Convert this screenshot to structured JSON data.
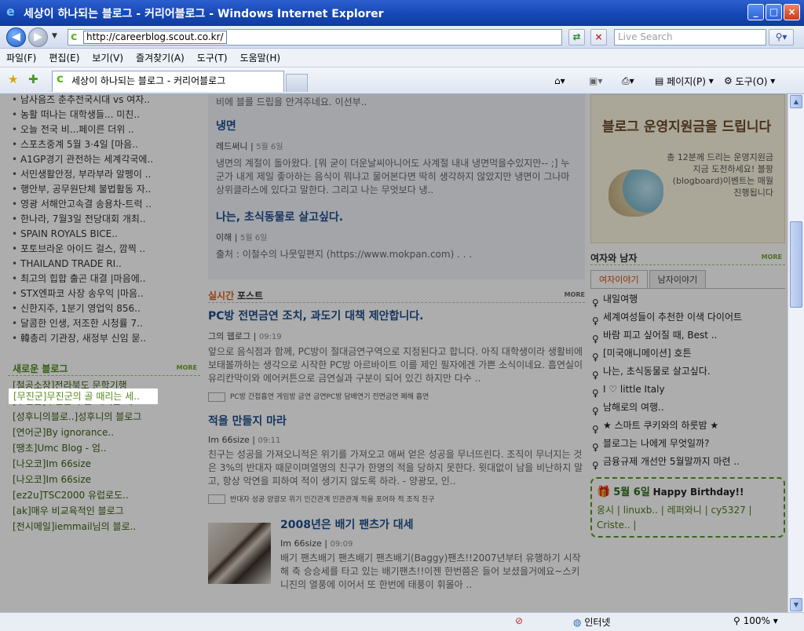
{
  "window": {
    "title": "세상이 하나되는 블로그 - 커리어블로그 - Windows Internet Explorer"
  },
  "address": {
    "url": "http://careerblog.scout.co.kr/",
    "search_placeholder": "Live Search"
  },
  "menu": [
    "파일(F)",
    "편집(E)",
    "보기(V)",
    "즐겨찾기(A)",
    "도구(T)",
    "도움말(H)"
  ],
  "tab": {
    "label": "세상이 하나되는 블로그 - 커리어블로그"
  },
  "toolbar": {
    "page_label": "페이지(P)",
    "tools_label": "도구(O)"
  },
  "left": {
    "top_list": [
      "남사음즈 춘추전국시대 vs 여자..",
      "농활 떠나는 대학생들... 미친..",
      "오늘 전국 비...페이른 더위 ..",
      "스포츠중계 5월 3·4일 [마음..",
      "A1GP경기 관전하는 세계각국에..",
      "서민생활안정, 부라부라 알펭이 ..",
      "행안부, 공무원단체 불법활동 자..",
      "영광 서해안고속결 송용차-트럭 ..",
      "한나라, 7월3일 전당대회 개최..",
      "SPAIN ROYALS BICE..",
      "포토브라운 아이드 걸스, 깜찍 ..",
      "THAILAND TRADE RI..",
      "최고의 힙합 출곤 대결 |마음에..",
      "STX엔파코 사장 송우익 |마음..",
      "신한지주, 1분기 영업익 856..",
      "달콤한 인생, 저조한 시청률 7..",
      "韓총리 기관장, 새정부 신임 묻.."
    ],
    "new_blogs_title": "새로운 블로그",
    "more": "MORE",
    "new_blogs": [
      "[철공소장]전라북도 문학기행",
      "[무진군]무진군의 골 때리는 세..",
      "[성후니의블로..]성후니의 블로그",
      "[연어군]By ignorance..",
      "[땡초]Umc Blog - 엄..",
      "[나오코]Im 66size",
      "[나오코]Im 66size",
      "[ez2u]TSC2000 유럽로도..",
      "[ak]매우 비교육적인 블로그",
      "[전시메일]iemmail님의 블로.."
    ]
  },
  "middle": {
    "top_posts": [
      {
        "intro": "비에 블를 드립을 안겨주네요. 이선부..",
        "title": "냉면",
        "author": "레드써니",
        "date": "5월 6일",
        "body": "냉면의 계절이 돌아왔다. [뭐 굳이 더운날씨아니어도 사계절 내내 냉면먹을수있지만-- ;] 누군가 내게 제일 좋아하는 음식이 뭐냐고 물어본다면 딱히 생각하지 않았지만 냉면이 그나마 상위클라스에 있다고 말한다. 그리고 나는 무엇보다 냉.."
      },
      {
        "title": "나는, 초식동물로 살고싶다.",
        "author": "이해",
        "date": "5월 6일",
        "body": "출처 : 이철수의 나뭇잎편지 (https://www.mokpan.com) . . ."
      }
    ],
    "realtime_title_a": "실시간",
    "realtime_title_b": "포스트",
    "more": "MORE",
    "posts": [
      {
        "title": "PC방 전면금연 조치, 과도기 대책 제안합니다.",
        "author": "그의 웹로그",
        "time": "09:19",
        "body": "앞으로 음식점과 함께, PC방이 절대금연구역으로 지정된다고 합니다. 아직 대학생이라 생활비에 보태볼까하는 생각으로 시작한 PC방 아르바이트 이를 제인 필자에겐 가쁜 소식이네요. 흡연실이 유리칸막이와 에어커튼으로 금연실과 구분이 되어 있긴 하지만 다수 ..",
        "tags": "PC방 간접흡연 게임방 금연 금연PC방 담배연기 전면금연 폐해 흡연"
      },
      {
        "title": "적을 만들지 마라",
        "author": "Im 66size",
        "time": "09:11",
        "body": "친구는 성공을 가져오니적은 위기를 가져오고 애써 얻은 성공을 무너뜨린다. 조직이 무너지는 것은 3%의 반대자 때문이며열명의 친구가 한명의 적을 당하지 못한다. 윗대없이 남을 비난하지 말고, 항상 악연을 피하여 적이 생기지 않도록 하라. - 양광모, 인..",
        "tags": "반대자 성공 양광모 위기 인간관계 인관관계 적을 포어하 적 조직 친구"
      },
      {
        "title": "2008년은 배기 팬츠가 대세",
        "author": "Im 66size",
        "time": "09:09",
        "body": "배기 팬츠배기 팬츠배기 팬츠배기(Baggy)팬츠!!2007년부터 유행하기 시작해 축 승승세를 타고 있는 배기팬츠!!이젠 한번쯤은 들어 보셨을거에요~스키니진의 열풍에 이어서 또 한번에 태풍이 휘몰아 .."
      }
    ]
  },
  "right": {
    "banner": {
      "line1": "블로그 운영지원금을 드립니다",
      "line2": "총 12분께 드리는 운영지원금 지금 도전하세요! 블팡(blogboard)이벤트는 매월 진행됩니다"
    },
    "section_title": "여자와 남자",
    "more": "MORE",
    "tabs": [
      "여자이야기",
      "남자이야기"
    ],
    "stories": [
      "내일여행",
      "세계여성들이 추천한 이색 다이어트",
      "바람 피고 싶어질 때, Best ..",
      "[미국애니메이션] 호튼",
      "나는, 초식동물로 살고싶다.",
      "I ♡ little Italy",
      "남해로의 여행..",
      "★ 스마트 쿠키와의 하룻밤 ★",
      "블로그는 나에게 무엇일까?",
      "금융규제 개선안 5월말까지 마련 .."
    ],
    "birthday": {
      "date": "5월 6일",
      "title": "Happy Birthday!!",
      "names": "옹시 | linuxb.. | 레퍼와니 | cy5327 | Criste.. |"
    }
  },
  "status": {
    "zone": "인터넷",
    "zoom": "100%"
  }
}
